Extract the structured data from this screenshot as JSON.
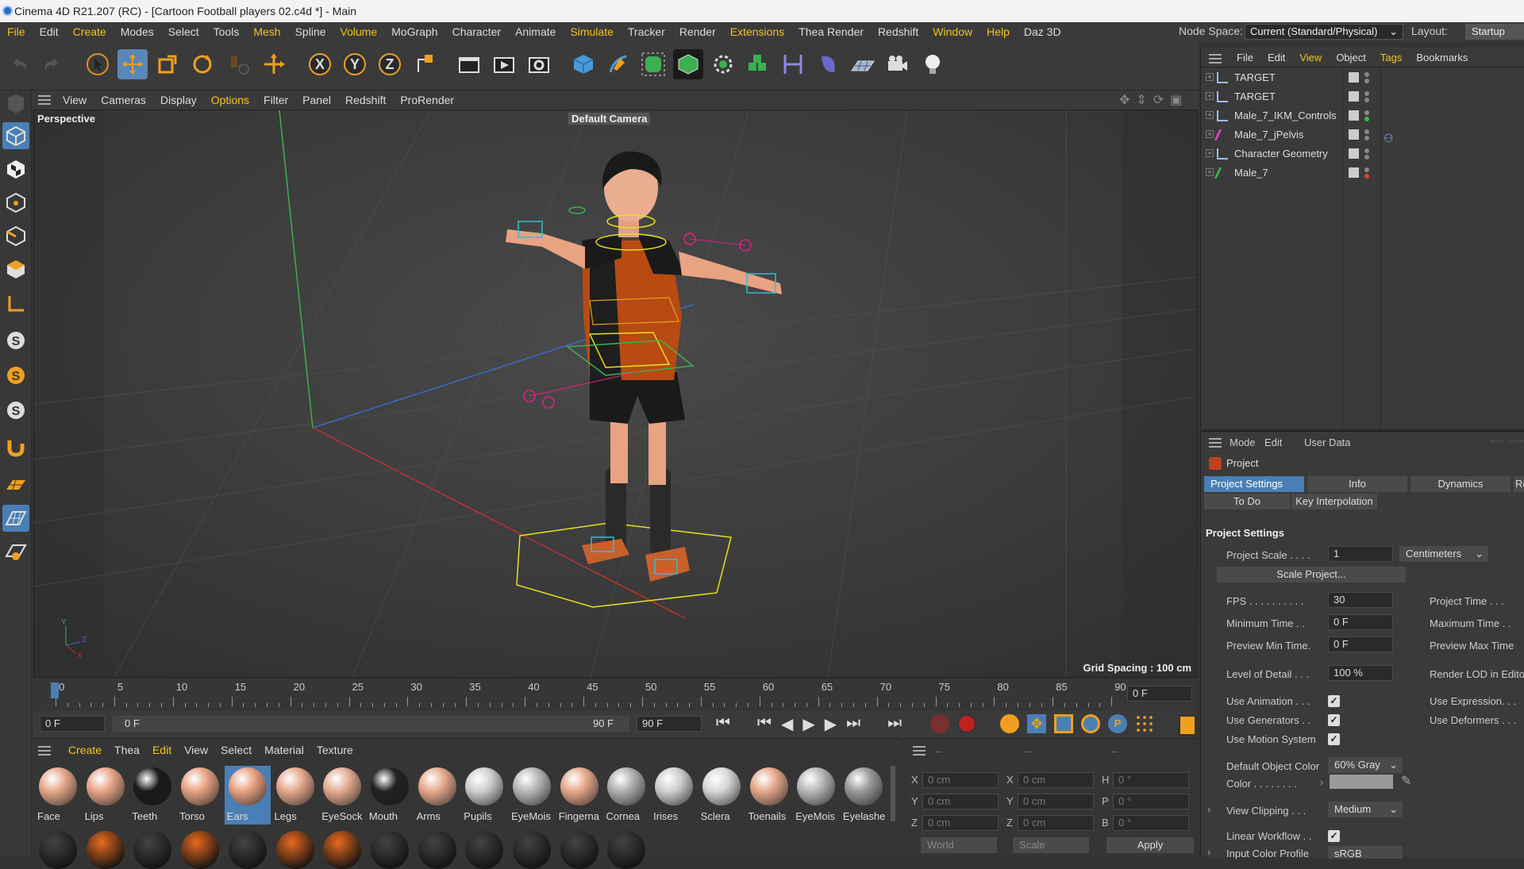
{
  "titlebar": {
    "title": "Cinema 4D R21.207 (RC) - [Cartoon Football players 02.c4d *] - Main"
  },
  "menubar": {
    "items": [
      "File",
      "Edit",
      "Create",
      "Modes",
      "Select",
      "Tools",
      "Mesh",
      "Spline",
      "Volume",
      "MoGraph",
      "Character",
      "Animate",
      "Simulate",
      "Tracker",
      "Render",
      "Extensions",
      "Thea Render",
      "Redshift",
      "Window",
      "Help",
      "Daz 3D"
    ],
    "highlighted": [
      "File",
      "Create",
      "Mesh",
      "Volume",
      "Simulate",
      "Extensions",
      "Window",
      "Help"
    ],
    "node_space_label": "Node Space:",
    "node_space_value": "Current (Standard/Physical)",
    "layout_label": "Layout:",
    "layout_value": "Startup"
  },
  "viewport": {
    "menu": [
      "View",
      "Cameras",
      "Display",
      "Options",
      "Filter",
      "Panel",
      "Redshift",
      "ProRender"
    ],
    "highlighted_menu": "Options",
    "label": "Perspective",
    "camera": "Default Camera",
    "grid_spacing": "Grid Spacing : 100 cm"
  },
  "timeline": {
    "ticks": [
      "0",
      "5",
      "10",
      "15",
      "20",
      "25",
      "30",
      "35",
      "40",
      "45",
      "50",
      "55",
      "60",
      "65",
      "70",
      "75",
      "80",
      "85",
      "90"
    ],
    "current_frame": "0 F",
    "start": "0 F",
    "range_start": "0 F",
    "range_end": "90 F",
    "end": "90 F"
  },
  "materials": {
    "menu": [
      "Create",
      "Thea",
      "Edit",
      "View",
      "Select",
      "Material",
      "Texture"
    ],
    "items": [
      {
        "name": "Face",
        "color": "#e6a98c"
      },
      {
        "name": "Lips",
        "color": "#e9a58a"
      },
      {
        "name": "Teeth",
        "color": "#1a1a1a"
      },
      {
        "name": "Torso",
        "color": "#e8a383"
      },
      {
        "name": "Ears",
        "color": "#e8a383"
      },
      {
        "name": "Legs",
        "color": "#e6a98c"
      },
      {
        "name": "EyeSock",
        "color": "#e5ad92"
      },
      {
        "name": "Mouth",
        "color": "#222222"
      },
      {
        "name": "Arms",
        "color": "#e6a98c"
      },
      {
        "name": "Pupils",
        "color": "#cfcfcf"
      },
      {
        "name": "EyeMois",
        "color": "#b8b8b8"
      },
      {
        "name": "Fingerna",
        "color": "#e6a98c"
      },
      {
        "name": "Cornea",
        "color": "#b0b0b0"
      },
      {
        "name": "Irises",
        "color": "#cfcfcf"
      },
      {
        "name": "Sclera",
        "color": "#d8d8d8"
      },
      {
        "name": "Toenails",
        "color": "#e6a98c"
      },
      {
        "name": "EyeMois",
        "color": "#b8b8b8"
      },
      {
        "name": "Eyelashe",
        "color": "#9a9a9a"
      }
    ],
    "selected": "Ears"
  },
  "coords": {
    "rows": [
      {
        "axis": "X",
        "pos": "0 cm",
        "size_axis": "X",
        "size": "0 cm",
        "rot_axis": "H",
        "rot": "0 °"
      },
      {
        "axis": "Y",
        "pos": "0 cm",
        "size_axis": "Y",
        "size": "0 cm",
        "rot_axis": "P",
        "rot": "0 °"
      },
      {
        "axis": "Z",
        "pos": "0 cm",
        "size_axis": "Z",
        "size": "0 cm",
        "rot_axis": "B",
        "rot": "0 °"
      }
    ],
    "headers": [
      "--",
      "--",
      "--"
    ],
    "space": "World",
    "mode": "Scale",
    "apply": "Apply"
  },
  "object_manager": {
    "menu": [
      "File",
      "Edit",
      "View",
      "Object",
      "Tags",
      "Bookmarks"
    ],
    "highlighted_menu": [
      "View",
      "Tags"
    ],
    "objects": [
      {
        "name": "TARGET",
        "icon": "bone-icon",
        "dot": "#888"
      },
      {
        "name": "TARGET",
        "icon": "bone-icon",
        "dot": "#888"
      },
      {
        "name": "Male_7_IKM_Controls",
        "icon": "bone-icon",
        "dot": "#3cc03c"
      },
      {
        "name": "Male_7_jPelvis",
        "icon": "joint-icon",
        "dot": "#888"
      },
      {
        "name": "Character Geometry",
        "icon": "null-icon",
        "dot": "#888"
      },
      {
        "name": "Male_7",
        "icon": "joint-icon",
        "dot": "#e04040"
      }
    ]
  },
  "attributes": {
    "menu": [
      "Mode",
      "Edit",
      "User Data"
    ],
    "title": "Project",
    "tabs": [
      "Project Settings",
      "Info",
      "Dynamics",
      "Referen"
    ],
    "tabs2": [
      "To Do",
      "Key Interpolation"
    ],
    "section": "Project Settings",
    "project_scale_label": "Project Scale . . . .",
    "project_scale": "1",
    "units": "Centimeters",
    "scale_button": "Scale Project...",
    "fps_label": "FPS . . . . . . . . . .",
    "fps": "30",
    "project_time_label": "Project Time . . .",
    "min_time_label": "Minimum Time . .",
    "min_time": "0 F",
    "max_time_label": "Maximum Time . .",
    "preview_min_label": "Preview Min Time.",
    "preview_min": "0 F",
    "preview_max_label": "Preview Max Time",
    "lod_label": "Level of Detail . . .",
    "lod": "100 %",
    "render_lod_label": "Render LOD in Edito",
    "use_animation_label": "Use Animation . . .",
    "use_expression_label": "Use Expression. . .",
    "use_generators_label": "Use Generators . .",
    "use_deformers_label": "Use Deformers . . .",
    "use_motion_label": "Use Motion System",
    "default_color_label": "Default Object Color",
    "default_color": "60% Gray",
    "color_label": "Color . . . . . . . .",
    "view_clipping_label": "View Clipping . . .",
    "view_clipping": "Medium",
    "linear_workflow_label": "Linear Workflow . .",
    "input_color_label": "Input Color Profile",
    "input_color": "sRGB"
  }
}
